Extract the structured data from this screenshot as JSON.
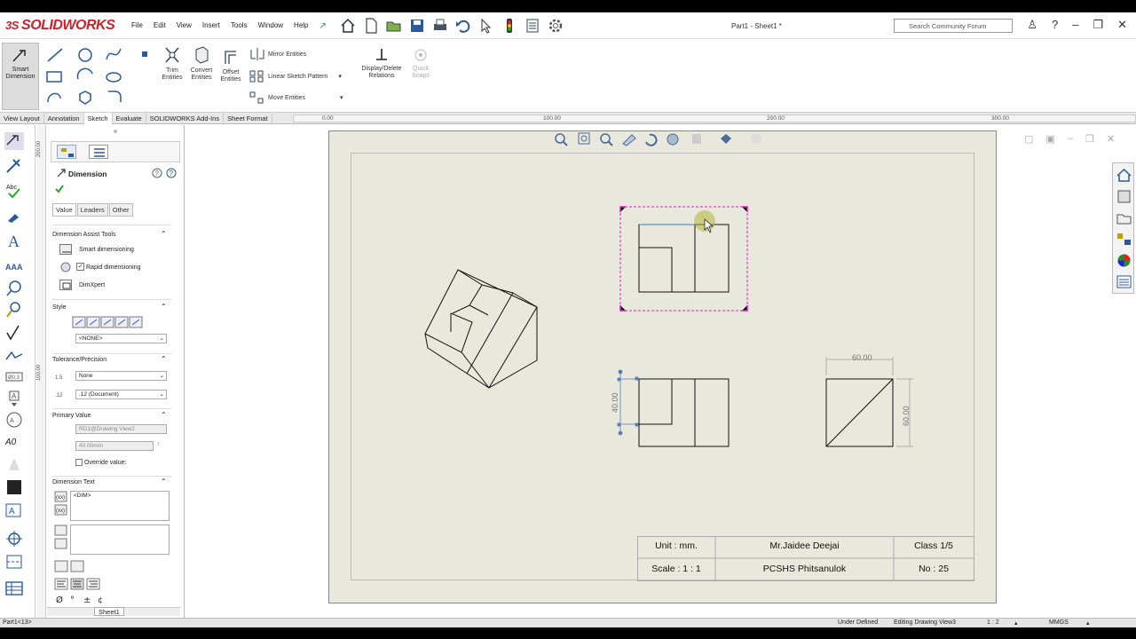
{
  "app": {
    "logo_text": "SOLIDWORKS",
    "document_title": "Part1 - Sheet1 *"
  },
  "menu": [
    "File",
    "Edit",
    "View",
    "Insert",
    "Tools",
    "Window",
    "Help"
  ],
  "search": {
    "placeholder": "Search Community Forum"
  },
  "ribbon": {
    "smart_dimension": "Smart Dimension",
    "trim": "Trim Entities",
    "convert": "Convert Entities",
    "offset": "Offset Entities",
    "mirror": "Mirror Entities",
    "linear_pattern": "Linear Sketch Pattern",
    "move": "Move Entities",
    "display_delete": "Display/Delete Relations",
    "quick_snaps": "Quick Snaps"
  },
  "tabs": [
    "View Layout",
    "Annotation",
    "Sketch",
    "Evaluate",
    "SOLIDWORKS Add-Ins",
    "Sheet Format"
  ],
  "active_tab": "Sketch",
  "ruler_h": [
    "0.00",
    "100.00",
    "200.00",
    "300.00"
  ],
  "ruler_v": [
    "200.00",
    "100.00"
  ],
  "property_manager": {
    "title": "Dimension",
    "tabs": [
      "Value",
      "Leaders",
      "Other"
    ],
    "assist_tools_header": "Dimension Assist Tools",
    "smart_dimensioning": "Smart dimensioning",
    "rapid_dimensioning": "Rapid dimensioning",
    "dimxpert": "DimXpert",
    "style_header": "Style",
    "style_value": "<NONE>",
    "tolerance_header": "Tolerance/Precision",
    "tolerance_value": "None",
    "precision_value": ".12 (Document)",
    "primary_value_header": "Primary Value",
    "primary_ref": "RD1@Drawing View2",
    "primary_value": "40.00mm",
    "override_label": "Override value:",
    "dimension_text_header": "Dimension Text",
    "dim_text": "<DIM>"
  },
  "sheet": {
    "dim_top": "60.00",
    "dim_right": "60.00",
    "dim_left": "40.00"
  },
  "title_block": {
    "unit": "Unit : mm.",
    "scale": "Scale : 1 : 1",
    "author": "Mr.Jaidee  Deejai",
    "school": "PCSHS  Phitsanulok",
    "class": "Class 1/5",
    "number": "No : 25"
  },
  "status": {
    "left": "Part1<13>",
    "state": "Under Defined",
    "editing": "Editing Drawing View3",
    "scale": "1 : 2",
    "units": "MMGS"
  },
  "sheet_tab": "Sheet1"
}
